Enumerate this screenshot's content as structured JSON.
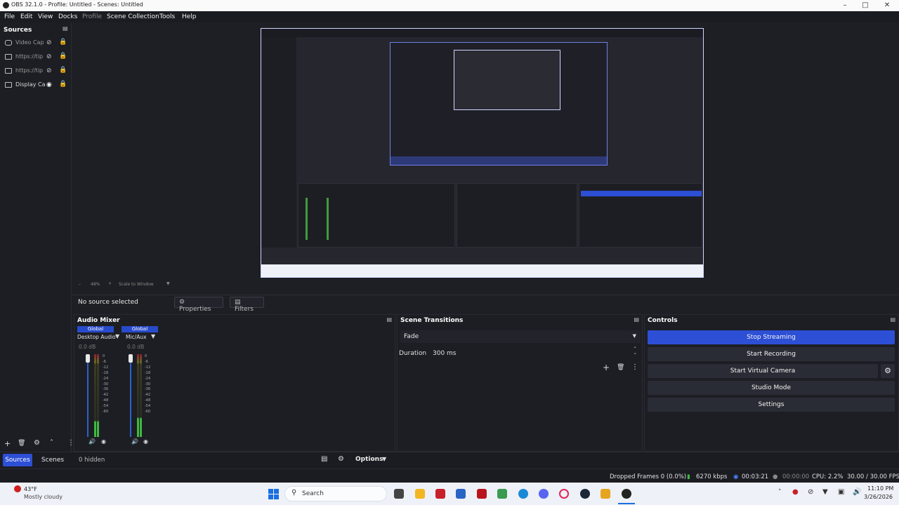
{
  "window": {
    "title": "OBS 32.1.0 - Profile: Untitled - Scenes: Untitled"
  },
  "menu": {
    "items": [
      "File",
      "Edit",
      "View",
      "Docks",
      "Profile",
      "Scene Collection",
      "Tools",
      "Help"
    ]
  },
  "sources": {
    "title": "Sources",
    "items": [
      {
        "label": "Video Cap",
        "visible": false,
        "icon": "camera-icon"
      },
      {
        "label": "https://tip",
        "visible": false,
        "icon": "browser-icon"
      },
      {
        "label": "https://tip",
        "visible": false,
        "icon": "browser-icon"
      },
      {
        "label": "Display Ca",
        "visible": true,
        "icon": "monitor-icon"
      }
    ],
    "hidden_count": "0 hidden"
  },
  "preview": {
    "zoom": "48%",
    "scale_mode": "Scale to Window"
  },
  "context": {
    "no_source": "No source selected",
    "properties": "Properties",
    "filters": "Filters"
  },
  "audio_mixer": {
    "title": "Audio Mixer",
    "channels": [
      {
        "group": "Global",
        "name": "Desktop Audio",
        "db": "0.0 dB",
        "level": 0.18
      },
      {
        "group": "Global",
        "name": "Mic/Aux",
        "db": "0.0 dB",
        "level": 0.22
      }
    ],
    "scale": [
      "0",
      "-6",
      "-12",
      "-18",
      "-24",
      "-30",
      "-36",
      "-42",
      "-48",
      "-54",
      "-60"
    ],
    "options": "Options"
  },
  "transitions": {
    "title": "Scene Transitions",
    "selected": "Fade",
    "duration_label": "Duration",
    "duration": "300 ms"
  },
  "controls": {
    "title": "Controls",
    "stop_streaming": "Stop Streaming",
    "start_recording": "Start Recording",
    "start_virtual_camera": "Start Virtual Camera",
    "studio_mode": "Studio Mode",
    "settings": "Settings"
  },
  "tabs": {
    "sources": "Sources",
    "scenes": "Scenes"
  },
  "status": {
    "dropped_frames": "Dropped Frames 0 (0.0%)",
    "bitrate": "6270 kbps",
    "stream_time": "00:03:21",
    "rec_time": "00:00:00",
    "cpu": "CPU: 2.2%",
    "fps": "30.00 / 30.00 FPS"
  },
  "taskbar": {
    "weather_temp": "43°F",
    "weather_desc": "Mostly cloudy",
    "search": "Search",
    "time": "11:10 PM",
    "date": "3/26/2026"
  },
  "colors": {
    "accent": "#2d4fd6",
    "panel": "#1d1e24",
    "button": "#2a2c35"
  }
}
